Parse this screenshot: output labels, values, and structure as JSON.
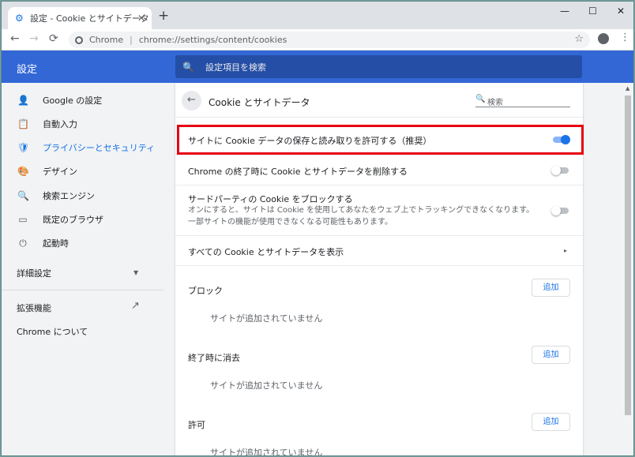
{
  "tab": {
    "title": "設定 - Cookie とサイトデータ",
    "close": "✕",
    "new_tab": "+"
  },
  "window_controls": {
    "minimize": "—",
    "maximize": "☐",
    "close": "✕"
  },
  "toolbar": {
    "back": "←",
    "forward": "→",
    "reload": "⟳",
    "site_label": "Chrome",
    "separator": "|",
    "url": "chrome://settings/content/cookies",
    "star": "☆",
    "menu": "⋮"
  },
  "header": {
    "title": "設定",
    "search_placeholder": "設定項目を検索"
  },
  "sidebar": {
    "items": [
      {
        "label": "Google の設定",
        "icon": "person-icon",
        "glyph": "👤"
      },
      {
        "label": "自動入力",
        "icon": "clipboard-icon",
        "glyph": "📋"
      },
      {
        "label": "プライバシーとセキュリティ",
        "icon": "shield-icon",
        "glyph": "🛡"
      },
      {
        "label": "デザイン",
        "icon": "palette-icon",
        "glyph": "🎨"
      },
      {
        "label": "検索エンジン",
        "icon": "search-icon",
        "glyph": "🔍"
      },
      {
        "label": "既定のブラウザ",
        "icon": "browser-icon",
        "glyph": "▭"
      },
      {
        "label": "起動時",
        "icon": "power-icon",
        "glyph": "⏻"
      }
    ],
    "advanced": "詳細設定",
    "caret": "▼",
    "extensions": "拡張機能",
    "external_link": "↗",
    "about": "Chrome について"
  },
  "subpage": {
    "back": "←",
    "title": "Cookie とサイトデータ",
    "search_icon": "🔍",
    "search_placeholder": "検索"
  },
  "rows": [
    {
      "label": "サイトに Cookie データの保存と読み取りを許可する（推奨）",
      "toggle": true
    },
    {
      "label": "Chrome の終了時に Cookie とサイトデータを削除する",
      "toggle": false
    },
    {
      "label": "サードパーティの Cookie をブロックする",
      "sub": "オンにすると、サイトは Cookie を使用してあなたをウェブ上でトラッキングできなくなります。一部サイトの機能が使用できなくなる可能性もあります。",
      "toggle": false
    },
    {
      "label": "すべての Cookie とサイトデータを表示",
      "arrow": "▸"
    }
  ],
  "sections": [
    {
      "label": "ブロック",
      "button": "追加",
      "empty": "サイトが追加されていません"
    },
    {
      "label": "終了時に消去",
      "button": "追加",
      "empty": "サイトが追加されていません"
    },
    {
      "label": "許可",
      "button": "追加",
      "empty": "サイトが追加されていません"
    }
  ],
  "scrollbar": {
    "up": "▲"
  },
  "colors": {
    "header_blue": "#3367d6",
    "accent": "#1a73e8",
    "highlight_red": "#e60012"
  }
}
